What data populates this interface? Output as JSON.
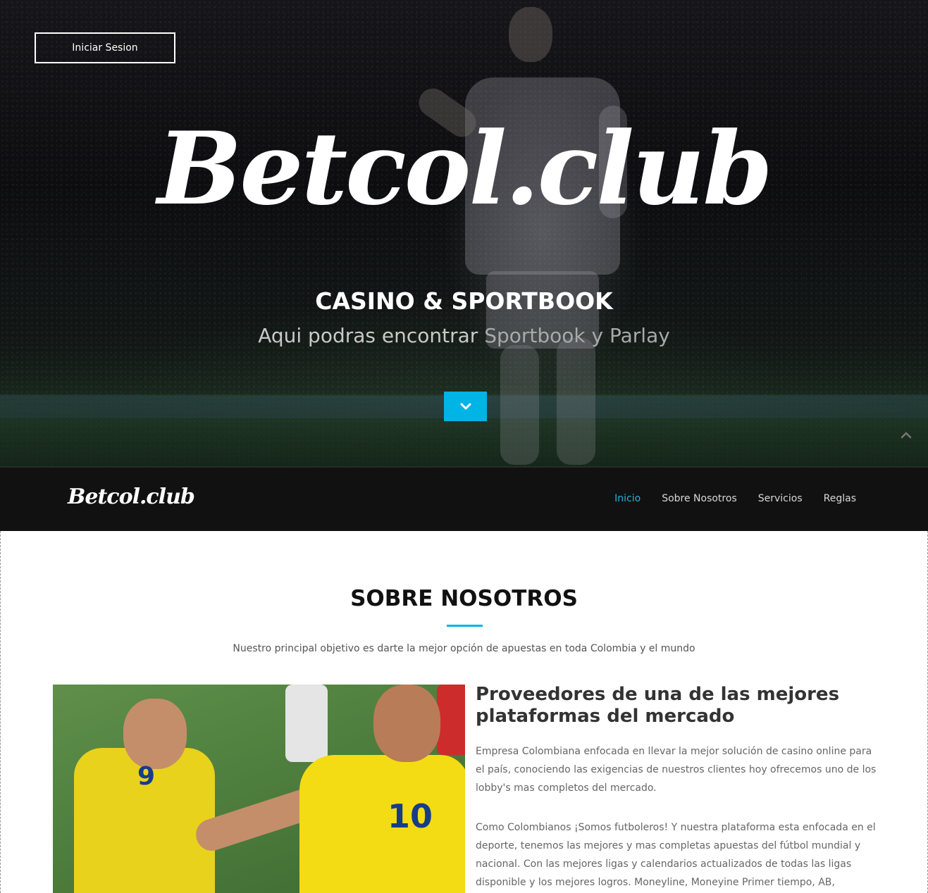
{
  "hero": {
    "login_label": "Iniciar Sesion",
    "logo": "Betcol.club",
    "title": "CASINO & SPORTBOOK",
    "subtitle_start": "Aqui podras encontrar",
    "subtitle_highlight": "Sportbook y Parlay"
  },
  "nav": {
    "logo": "Betcol.club",
    "items": [
      {
        "label": "Inicio",
        "active": true
      },
      {
        "label": "Sobre Nosotros",
        "active": false
      },
      {
        "label": "Servicios",
        "active": false
      },
      {
        "label": "Reglas",
        "active": false
      }
    ]
  },
  "about": {
    "title": "SOBRE NOSOTROS",
    "lead": "Nuestro principal objetivo es darte la mejor opción de apuestas en toda Colombia y el mundo",
    "heading": "Proveedores de una de las mejores plataformas del mercado",
    "paragraph1": "Empresa Colombiana enfocada en llevar la mejor solución de casino online para el país, conociendo las exigencias de nuestros clientes hoy ofrecemos uno de los lobby's mas completos del mercado.",
    "paragraph2": "Como Colombianos ¡Somos futboleros! Y nuestra plataforma esta enfocada en el deporte, tenemos las mejores y mas completas apuestas del fútbol mundial y nacional. Con las mejores ligas y calendarios actualizados de todas las ligas disponible y los mejores logros. Moneyline, Moneyine Primer tiempo, AB,"
  },
  "colors": {
    "accent": "#00b4e6",
    "navbar_bg": "#111111",
    "active_link": "#1fb5dc"
  },
  "icons": {
    "scroll_down": "chevron-down-icon",
    "back_to_top": "chevron-up-icon"
  }
}
